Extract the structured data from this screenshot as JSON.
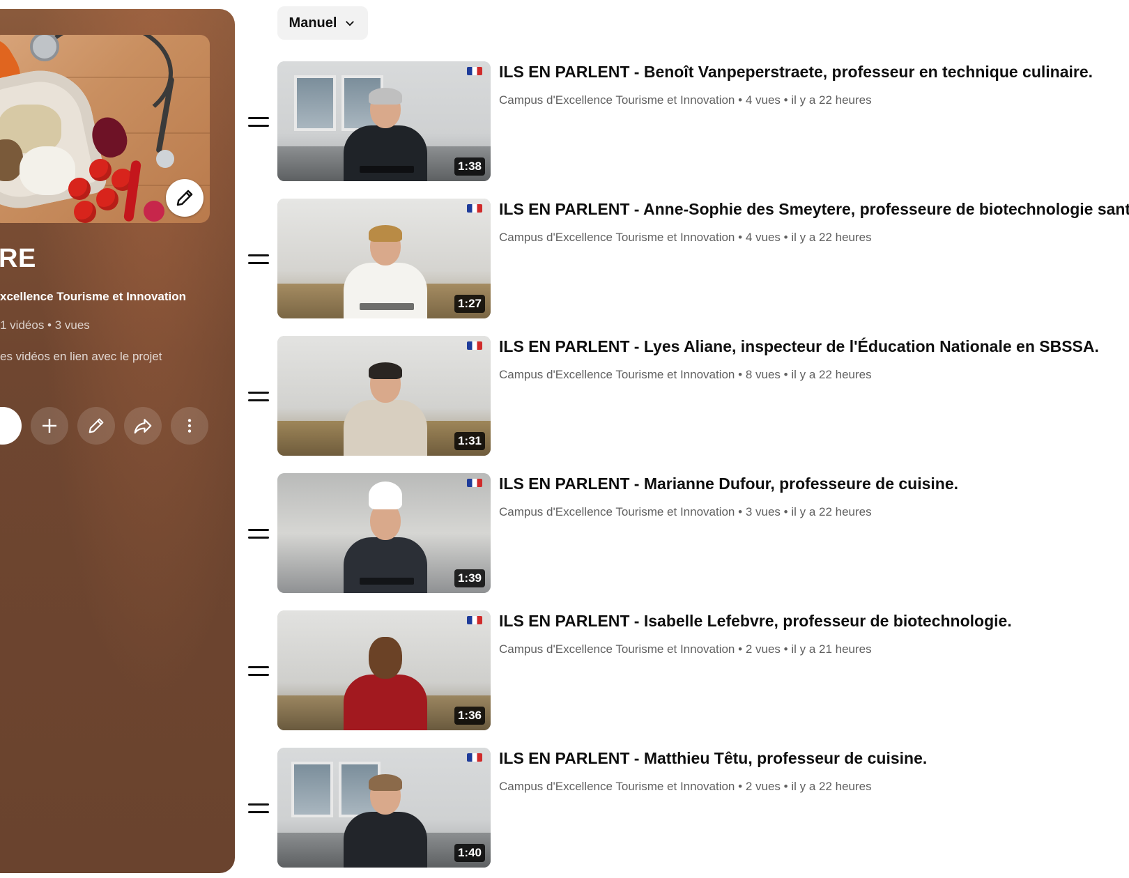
{
  "playlist": {
    "title": "RE",
    "owner": "xcellence Tourisme et Innovation",
    "stats": "1 vidéos • 3 vues",
    "description": "es vidéos en lien avec le projet"
  },
  "sort": {
    "label": "Manuel"
  },
  "videos": [
    {
      "title": "ILS EN PARLENT - Benoît Vanpeperstraete, professeur en technique culinaire.",
      "channel": "Campus d'Excellence Tourisme et Innovation",
      "views": "4 vues",
      "age": "il y a 22 heures",
      "duration": "1:38"
    },
    {
      "title": "ILS EN PARLENT - Anne-Sophie des Smeytere, professeure de biotechnologie santé",
      "channel": "Campus d'Excellence Tourisme et Innovation",
      "views": "4 vues",
      "age": "il y a 22 heures",
      "duration": "1:27"
    },
    {
      "title": "ILS EN PARLENT - Lyes Aliane, inspecteur de l'Éducation Nationale en SBSSA.",
      "channel": "Campus d'Excellence Tourisme et Innovation",
      "views": "8 vues",
      "age": "il y a 22 heures",
      "duration": "1:31"
    },
    {
      "title": "ILS EN PARLENT - Marianne Dufour, professeure de cuisine.",
      "channel": "Campus d'Excellence Tourisme et Innovation",
      "views": "3 vues",
      "age": "il y a 22 heures",
      "duration": "1:39"
    },
    {
      "title": "ILS EN PARLENT - Isabelle Lefebvre, professeur de biotechnologie.",
      "channel": "Campus d'Excellence Tourisme et Innovation",
      "views": "2 vues",
      "age": "il y a 21 heures",
      "duration": "1:36"
    },
    {
      "title": "ILS EN PARLENT - Matthieu Têtu, professeur de cuisine.",
      "channel": "Campus d'Excellence Tourisme et Innovation",
      "views": "2 vues",
      "age": "il y a 22 heures",
      "duration": "1:40"
    }
  ],
  "meta_separator": "•",
  "icons": {
    "cover_edit": "pencil-icon",
    "add": "plus-icon",
    "edit": "pencil-icon",
    "share": "share-icon",
    "more": "more-vert-icon",
    "sort": "chevron-down-icon",
    "drag": "drag-handle-icon"
  },
  "colors": {
    "panel": "#6f4630",
    "chip": "#f2f2f2",
    "meta_text": "#606060",
    "title_text": "#0f0f0f"
  }
}
